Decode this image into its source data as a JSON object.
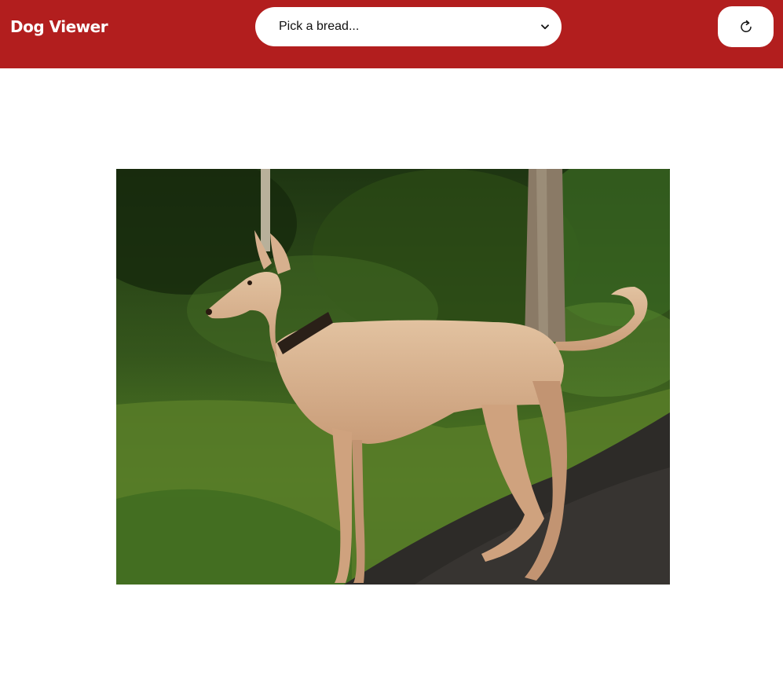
{
  "header": {
    "title": "Dog Viewer",
    "background_color": "#b21e1e"
  },
  "breed_select": {
    "selected": "Pick a bread...",
    "icon": "chevron-down-icon"
  },
  "refresh_button": {
    "icon": "refresh-icon"
  },
  "image": {
    "subject": "photo of a fawn sighthound standing on a path beside green foliage"
  }
}
